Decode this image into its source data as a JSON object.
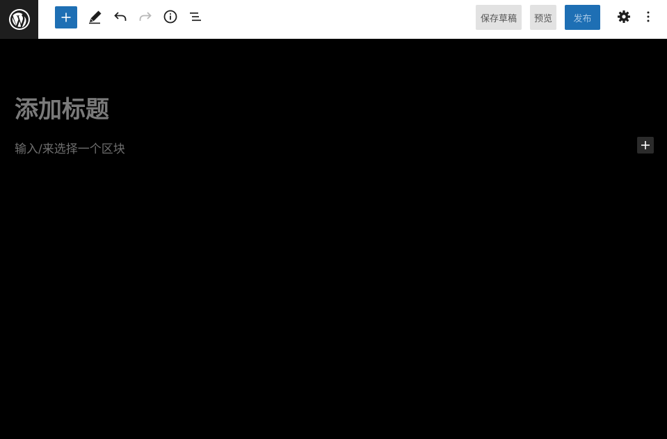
{
  "toolbar": {
    "save_draft_label": "保存草稿",
    "preview_label": "预览",
    "publish_label": "发布"
  },
  "editor": {
    "title_placeholder": "添加标题",
    "block_placeholder": "输入/来选择一个区块"
  },
  "colors": {
    "accent": "#1e6fb4",
    "logo_bg": "#1e1e1e",
    "canvas_bg": "#000000"
  },
  "icons": {
    "logo": "wordpress-logo-icon",
    "inserter": "plus-icon",
    "tools": "pencil-icon",
    "undo": "undo-icon",
    "redo": "redo-icon",
    "details": "info-icon",
    "outline": "list-view-icon",
    "settings": "gear-icon",
    "options": "more-vertical-icon"
  }
}
